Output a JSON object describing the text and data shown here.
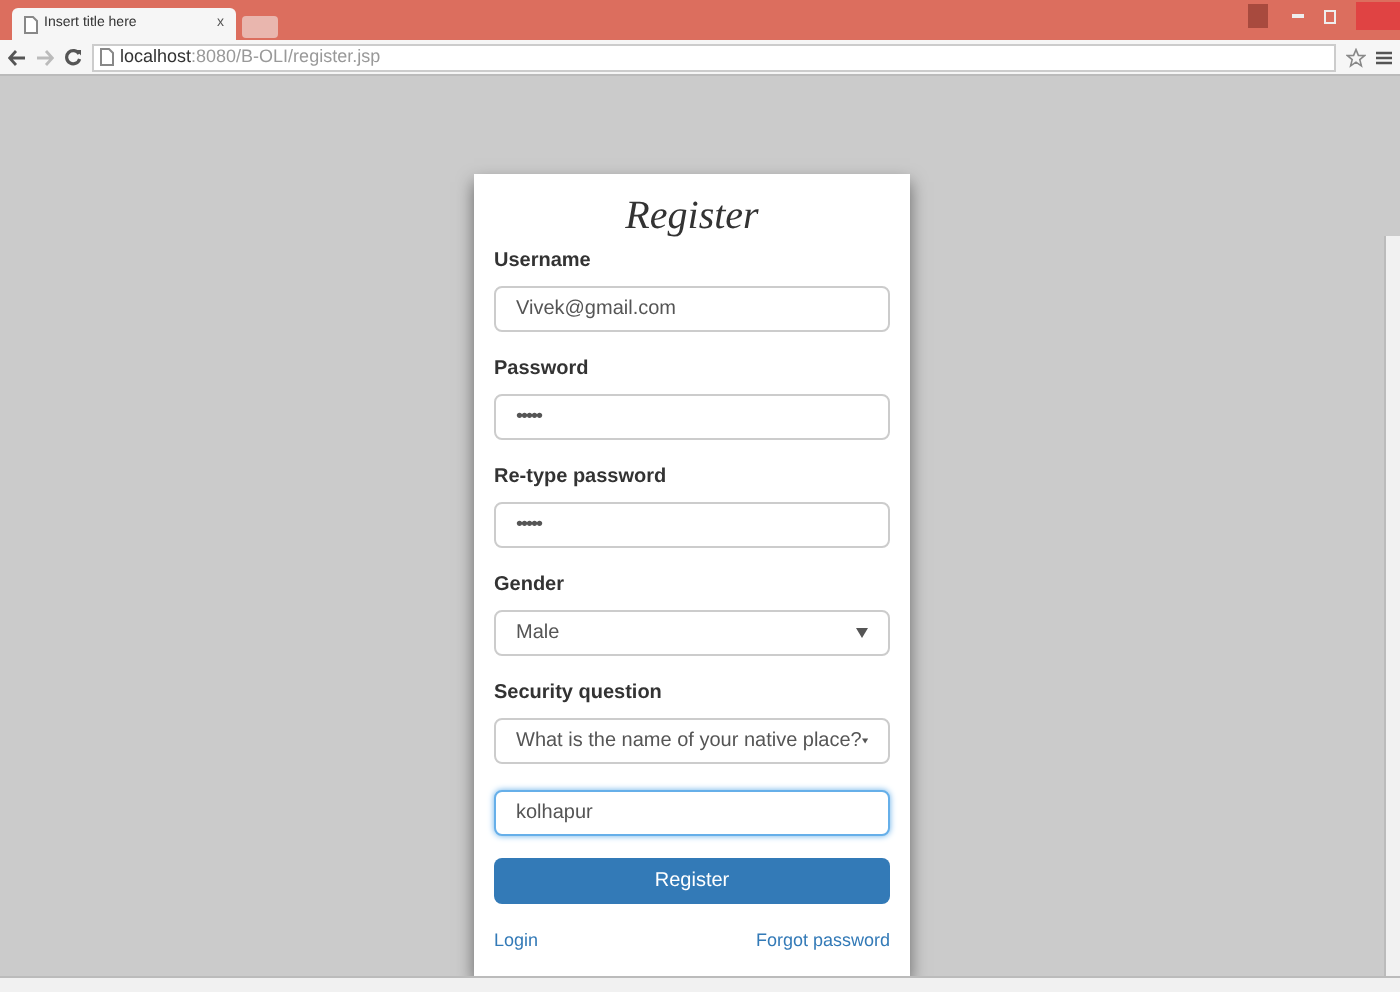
{
  "browser": {
    "tab": {
      "title": "Insert title here",
      "close": "x"
    },
    "url_host": "localhost",
    "url_path": ":8080/B-OLI/register.jsp"
  },
  "form": {
    "title": "Register",
    "fields": [
      {
        "kind": "text",
        "label": "Username",
        "value": "Vivek@gmail.com",
        "focused": false
      },
      {
        "kind": "password",
        "label": "Password",
        "value": "•••••",
        "focused": false
      },
      {
        "kind": "password",
        "label": "Re-type password",
        "value": "•••••",
        "focused": false
      },
      {
        "kind": "select",
        "label": "Gender",
        "value": "Male",
        "focused": false
      },
      {
        "kind": "select",
        "label": "Security question",
        "value": "What is the name of your native place?",
        "focused": false
      },
      {
        "kind": "text",
        "value": "kolhapur",
        "focused": true
      }
    ],
    "submit": "Register",
    "links": [
      "Login",
      "Forgot password"
    ]
  }
}
